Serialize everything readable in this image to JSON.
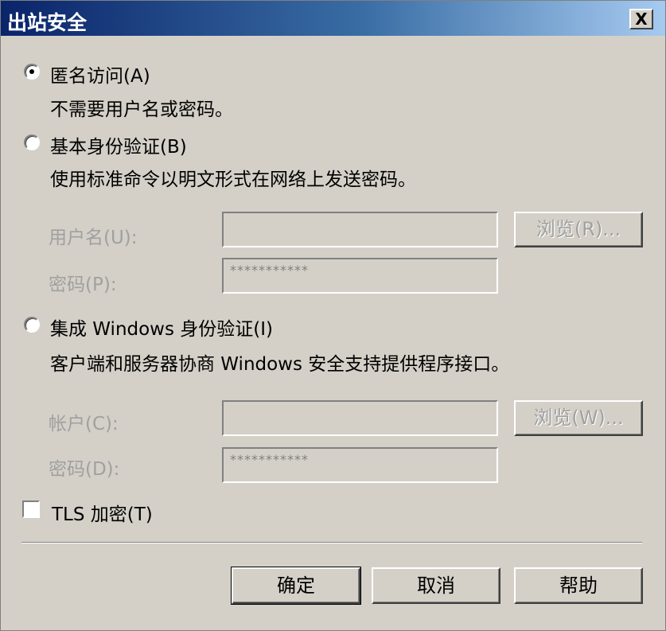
{
  "dialog": {
    "title": "出站安全",
    "close_label": "X"
  },
  "auth": {
    "anonymous": {
      "label": "匿名访问(A)",
      "description": "不需要用户名或密码。",
      "selected": true
    },
    "basic": {
      "label": "基本身份验证(B)",
      "description": "使用标准命令以明文形式在网络上发送密码。",
      "selected": false,
      "username_label": "用户名(U):",
      "username_value": "",
      "browse_label": "浏览(R)...",
      "password_label": "密码(P):",
      "password_value": "***********"
    },
    "windows": {
      "label": "集成 Windows 身份验证(I)",
      "description": "客户端和服务器协商 Windows 安全支持提供程序接口。",
      "selected": false,
      "account_label": "帐户(C):",
      "account_value": "",
      "browse_label": "浏览(W)...",
      "password_label": "密码(D):",
      "password_value": "***********"
    }
  },
  "tls": {
    "label": "TLS 加密(T)",
    "checked": false
  },
  "buttons": {
    "ok": "确定",
    "cancel": "取消",
    "help": "帮助"
  }
}
